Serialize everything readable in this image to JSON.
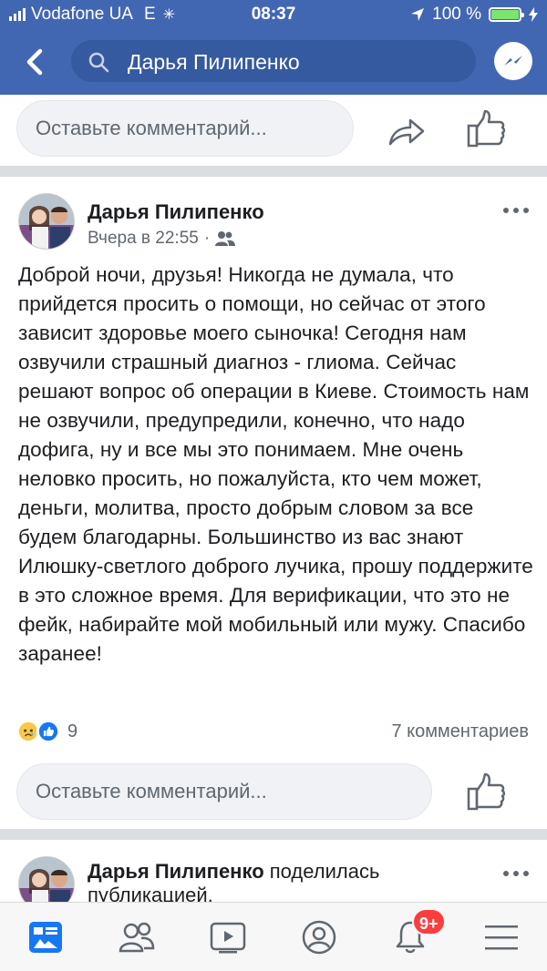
{
  "status_bar": {
    "carrier": "Vodafone UA",
    "network": "E",
    "time": "08:37",
    "battery": "100 %"
  },
  "nav": {
    "search_value": "Дарья Пилипенко"
  },
  "comment_box_top": {
    "placeholder": "Оставьте комментарий..."
  },
  "post": {
    "author": "Дарья Пилипенко",
    "timestamp": "Вчера в 22:55",
    "meta_separator": "·",
    "text": "Доброй ночи, друзья! Никогда не думала, что прийдется просить о помощи, но сейчас от этого зависит здоровье моего сыночка! Сегодня нам озвучили страшный диагноз - глиома. Сейчас решают вопрос об операции в Киеве. Стоимость нам не озвучили, предупредили, конечно, что надо дофига, ну и все мы это понимаем. Мне очень неловко просить, но пожалуйста, кто чем может, деньги, молитва, просто добрым словом за все будем благодарны. Большинство из вас знают Илюшку-светлого доброго лучика, прошу поддержите в это сложное время. Для верификации, что это не фейк, набирайте мой мобильный или мужу. Спасибо заранее!",
    "reactions_count": "9",
    "comments_count": "7 комментариев"
  },
  "comment_box_bottom": {
    "placeholder": "Оставьте комментарий..."
  },
  "next_post": {
    "author": "Дарья Пилипенко",
    "action_line1": "поделилась",
    "action_line2": "публикацией."
  },
  "tabbar": {
    "notifications_badge": "9+"
  },
  "colors": {
    "brand_blue": "#4267b2",
    "badge_red": "#fa3e3e",
    "text_secondary": "#606770"
  }
}
